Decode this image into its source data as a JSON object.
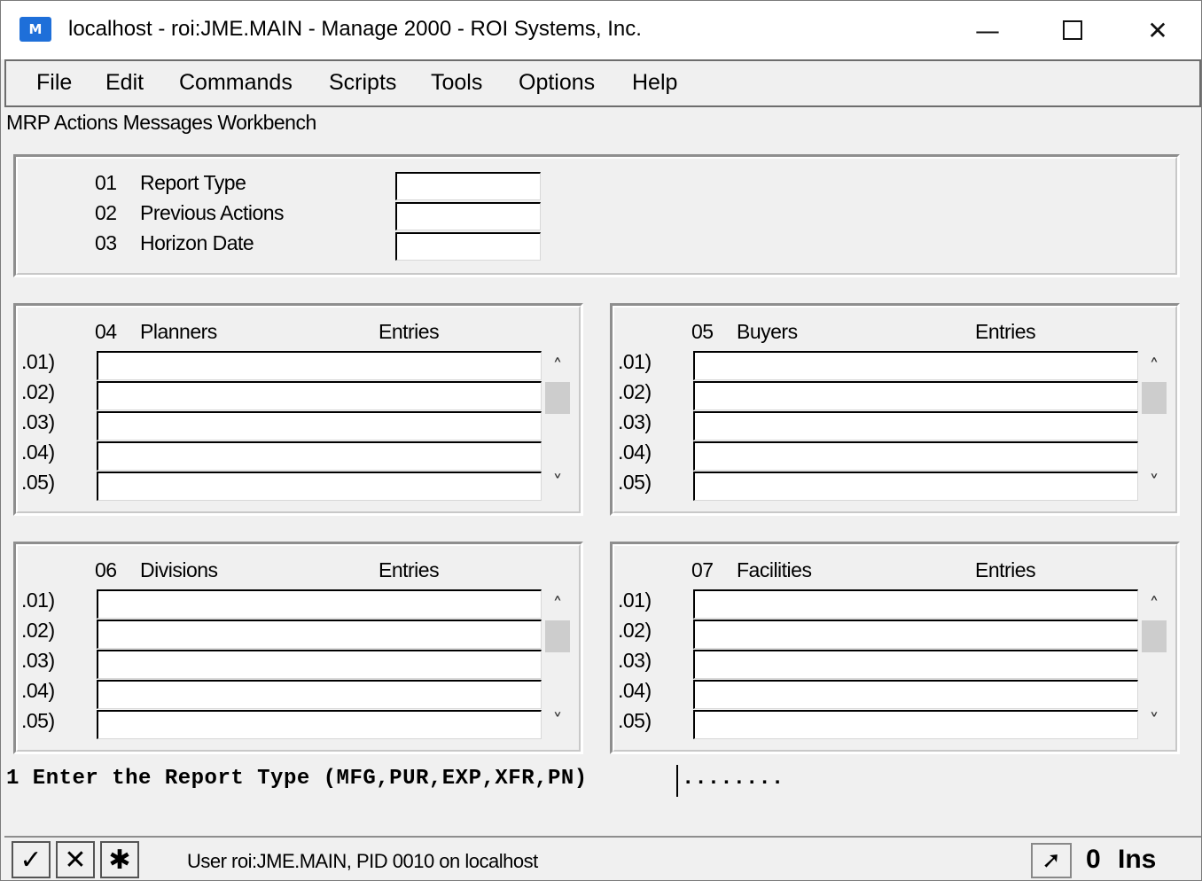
{
  "window": {
    "icon_text": "M",
    "title": "localhost - roi:JME.MAIN - Manage 2000 - ROI Systems, Inc.",
    "minimize_glyph": "—",
    "close_glyph": "✕"
  },
  "menu": [
    "File",
    "Edit",
    "Commands",
    "Scripts",
    "Tools",
    "Options",
    "Help"
  ],
  "form_title": "MRP Actions Messages Workbench",
  "header_fields": [
    {
      "num": "01",
      "label": "Report Type",
      "value": ""
    },
    {
      "num": "02",
      "label": "Previous Actions",
      "value": ""
    },
    {
      "num": "03",
      "label": "Horizon Date",
      "value": ""
    }
  ],
  "groups": [
    {
      "num": "04",
      "title": "Planners",
      "entries_label": "Entries",
      "rows": [
        ".01)",
        ".02)",
        ".03)",
        ".04)",
        ".05)"
      ]
    },
    {
      "num": "05",
      "title": "Buyers",
      "entries_label": "Entries",
      "rows": [
        ".01)",
        ".02)",
        ".03)",
        ".04)",
        ".05)"
      ]
    },
    {
      "num": "06",
      "title": "Divisions",
      "entries_label": "Entries",
      "rows": [
        ".01)",
        ".02)",
        ".03)",
        ".04)",
        ".05)"
      ]
    },
    {
      "num": "07",
      "title": "Facilities",
      "entries_label": "Entries",
      "rows": [
        ".01)",
        ".02)",
        ".03)",
        ".04)",
        ".05)"
      ]
    }
  ],
  "prompt": {
    "text": "1 Enter the Report Type (MFG,PUR,EXP,XFR,PN) ",
    "fill": "........"
  },
  "status": {
    "accept_glyph": "✓",
    "cancel_glyph": "✕",
    "star_glyph": "✱",
    "text": "User roi:JME.MAIN, PID 0010 on localhost",
    "cursor_glyph": "➚",
    "count": "0",
    "mode": "Ins"
  }
}
